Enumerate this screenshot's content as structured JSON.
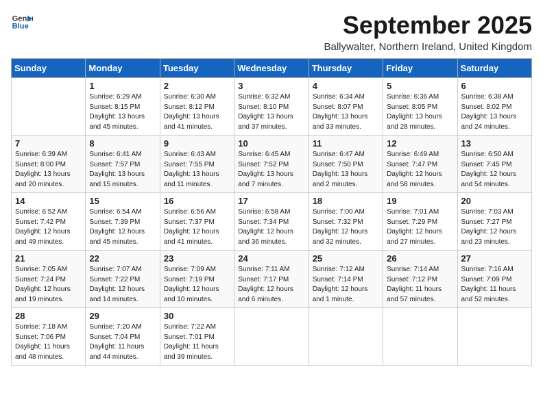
{
  "logo": {
    "line1": "General",
    "line2": "Blue"
  },
  "title": "September 2025",
  "location": "Ballywalter, Northern Ireland, United Kingdom",
  "days_of_week": [
    "Sunday",
    "Monday",
    "Tuesday",
    "Wednesday",
    "Thursday",
    "Friday",
    "Saturday"
  ],
  "weeks": [
    [
      {
        "day": "",
        "info": ""
      },
      {
        "day": "1",
        "info": "Sunrise: 6:29 AM\nSunset: 8:15 PM\nDaylight: 13 hours\nand 45 minutes."
      },
      {
        "day": "2",
        "info": "Sunrise: 6:30 AM\nSunset: 8:12 PM\nDaylight: 13 hours\nand 41 minutes."
      },
      {
        "day": "3",
        "info": "Sunrise: 6:32 AM\nSunset: 8:10 PM\nDaylight: 13 hours\nand 37 minutes."
      },
      {
        "day": "4",
        "info": "Sunrise: 6:34 AM\nSunset: 8:07 PM\nDaylight: 13 hours\nand 33 minutes."
      },
      {
        "day": "5",
        "info": "Sunrise: 6:36 AM\nSunset: 8:05 PM\nDaylight: 13 hours\nand 28 minutes."
      },
      {
        "day": "6",
        "info": "Sunrise: 6:38 AM\nSunset: 8:02 PM\nDaylight: 13 hours\nand 24 minutes."
      }
    ],
    [
      {
        "day": "7",
        "info": "Sunrise: 6:39 AM\nSunset: 8:00 PM\nDaylight: 13 hours\nand 20 minutes."
      },
      {
        "day": "8",
        "info": "Sunrise: 6:41 AM\nSunset: 7:57 PM\nDaylight: 13 hours\nand 15 minutes."
      },
      {
        "day": "9",
        "info": "Sunrise: 6:43 AM\nSunset: 7:55 PM\nDaylight: 13 hours\nand 11 minutes."
      },
      {
        "day": "10",
        "info": "Sunrise: 6:45 AM\nSunset: 7:52 PM\nDaylight: 13 hours\nand 7 minutes."
      },
      {
        "day": "11",
        "info": "Sunrise: 6:47 AM\nSunset: 7:50 PM\nDaylight: 13 hours\nand 2 minutes."
      },
      {
        "day": "12",
        "info": "Sunrise: 6:49 AM\nSunset: 7:47 PM\nDaylight: 12 hours\nand 58 minutes."
      },
      {
        "day": "13",
        "info": "Sunrise: 6:50 AM\nSunset: 7:45 PM\nDaylight: 12 hours\nand 54 minutes."
      }
    ],
    [
      {
        "day": "14",
        "info": "Sunrise: 6:52 AM\nSunset: 7:42 PM\nDaylight: 12 hours\nand 49 minutes."
      },
      {
        "day": "15",
        "info": "Sunrise: 6:54 AM\nSunset: 7:39 PM\nDaylight: 12 hours\nand 45 minutes."
      },
      {
        "day": "16",
        "info": "Sunrise: 6:56 AM\nSunset: 7:37 PM\nDaylight: 12 hours\nand 41 minutes."
      },
      {
        "day": "17",
        "info": "Sunrise: 6:58 AM\nSunset: 7:34 PM\nDaylight: 12 hours\nand 36 minutes."
      },
      {
        "day": "18",
        "info": "Sunrise: 7:00 AM\nSunset: 7:32 PM\nDaylight: 12 hours\nand 32 minutes."
      },
      {
        "day": "19",
        "info": "Sunrise: 7:01 AM\nSunset: 7:29 PM\nDaylight: 12 hours\nand 27 minutes."
      },
      {
        "day": "20",
        "info": "Sunrise: 7:03 AM\nSunset: 7:27 PM\nDaylight: 12 hours\nand 23 minutes."
      }
    ],
    [
      {
        "day": "21",
        "info": "Sunrise: 7:05 AM\nSunset: 7:24 PM\nDaylight: 12 hours\nand 19 minutes."
      },
      {
        "day": "22",
        "info": "Sunrise: 7:07 AM\nSunset: 7:22 PM\nDaylight: 12 hours\nand 14 minutes."
      },
      {
        "day": "23",
        "info": "Sunrise: 7:09 AM\nSunset: 7:19 PM\nDaylight: 12 hours\nand 10 minutes."
      },
      {
        "day": "24",
        "info": "Sunrise: 7:11 AM\nSunset: 7:17 PM\nDaylight: 12 hours\nand 6 minutes."
      },
      {
        "day": "25",
        "info": "Sunrise: 7:12 AM\nSunset: 7:14 PM\nDaylight: 12 hours\nand 1 minute."
      },
      {
        "day": "26",
        "info": "Sunrise: 7:14 AM\nSunset: 7:12 PM\nDaylight: 11 hours\nand 57 minutes."
      },
      {
        "day": "27",
        "info": "Sunrise: 7:16 AM\nSunset: 7:09 PM\nDaylight: 11 hours\nand 52 minutes."
      }
    ],
    [
      {
        "day": "28",
        "info": "Sunrise: 7:18 AM\nSunset: 7:06 PM\nDaylight: 11 hours\nand 48 minutes."
      },
      {
        "day": "29",
        "info": "Sunrise: 7:20 AM\nSunset: 7:04 PM\nDaylight: 11 hours\nand 44 minutes."
      },
      {
        "day": "30",
        "info": "Sunrise: 7:22 AM\nSunset: 7:01 PM\nDaylight: 11 hours\nand 39 minutes."
      },
      {
        "day": "",
        "info": ""
      },
      {
        "day": "",
        "info": ""
      },
      {
        "day": "",
        "info": ""
      },
      {
        "day": "",
        "info": ""
      }
    ]
  ]
}
